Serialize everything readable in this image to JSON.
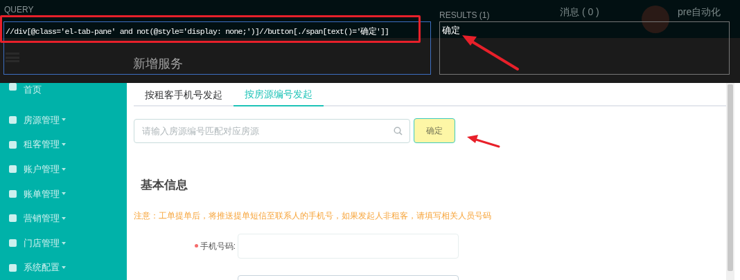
{
  "app_header": {
    "notifications": "消息 ( 0 )",
    "user": "pre自动化",
    "page_title": "新增服务"
  },
  "query_panel": {
    "query_label": "QUERY",
    "query": "//div[@class='el-tab-pane' and not(@style='display: none;')]//button[./span[text()='确定']]",
    "results_label": "RESULTS (1)",
    "results": [
      "确定"
    ]
  },
  "sidebar": {
    "items": [
      {
        "label": "首页",
        "has_submenu": false
      },
      {
        "label": "房源管理",
        "has_submenu": true
      },
      {
        "label": "租客管理",
        "has_submenu": true
      },
      {
        "label": "账户管理",
        "has_submenu": true
      },
      {
        "label": "账单管理",
        "has_submenu": true
      },
      {
        "label": "营销管理",
        "has_submenu": true
      },
      {
        "label": "门店管理",
        "has_submenu": true
      },
      {
        "label": "系统配置",
        "has_submenu": true
      }
    ]
  },
  "tabs": [
    {
      "label": "按租客手机号发起",
      "selected": false
    },
    {
      "label": "按房源编号发起",
      "selected": true
    }
  ],
  "search": {
    "placeholder": "请输入房源编号匹配对应房源",
    "button": "确定"
  },
  "section_title": "基本信息",
  "notice": "注意：工单提单后，将推送提单短信至联系人的手机号，如果发起人非租客，请填写相关人员号码",
  "form_fields": [
    {
      "label": "手机号码:",
      "required": true
    }
  ]
}
